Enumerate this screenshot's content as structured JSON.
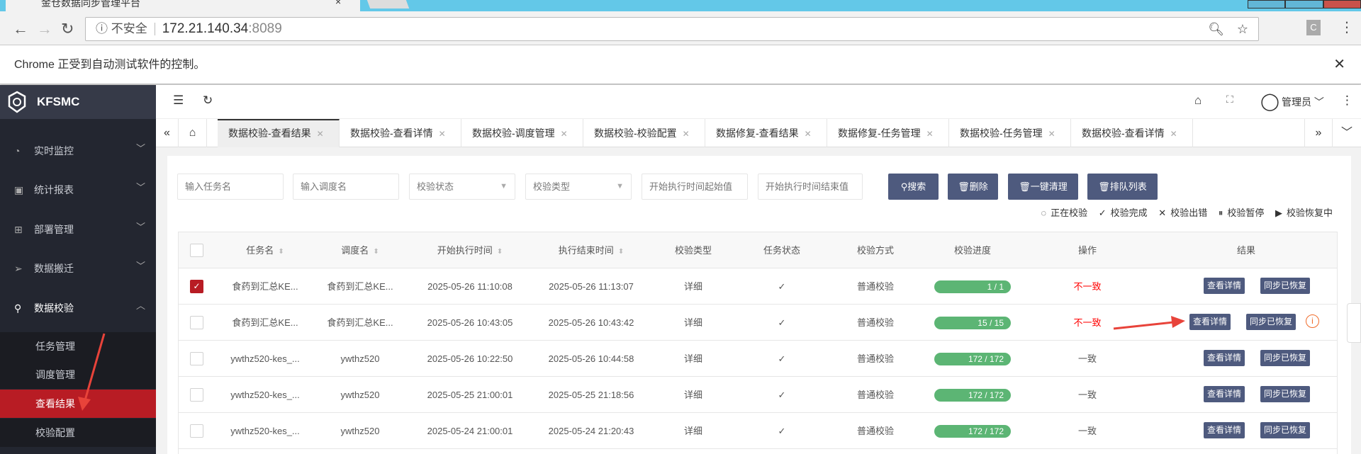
{
  "browser": {
    "tab_title": "金仓数据同步管理平台",
    "security": "不安全",
    "url_host": "172.21.140.34",
    "url_port": ":8089",
    "ext": "C",
    "infobar": "Chrome 正受到自动测试软件的控制。"
  },
  "app": {
    "logo": "KFSMC",
    "user": "管理员"
  },
  "sidebar": {
    "items": [
      {
        "label": "实时监控",
        "icon": "dashboard-icon"
      },
      {
        "label": "统计报表",
        "icon": "report-icon"
      },
      {
        "label": "部署管理",
        "icon": "apps-icon"
      },
      {
        "label": "数据搬迁",
        "icon": "send-icon"
      },
      {
        "label": "数据校验",
        "icon": "search-icon"
      }
    ],
    "sub": [
      "任务管理",
      "调度管理",
      "查看结果",
      "校验配置"
    ],
    "active_sub": "查看结果"
  },
  "tabs": [
    "数据校验-查看结果",
    "数据校验-查看详情",
    "数据校验-调度管理",
    "数据校验-校验配置",
    "数据修复-查看结果",
    "数据修复-任务管理",
    "数据校验-任务管理",
    "数据校验-查看详情"
  ],
  "filters": {
    "task_name": "输入任务名",
    "schedule_name": "输入调度名",
    "status": "校验状态",
    "type": "校验类型",
    "start_from": "开始执行时间起始值",
    "start_to": "开始执行时间结束值"
  },
  "buttons": {
    "search": "搜索",
    "delete": "删除",
    "clear": "一键清理",
    "queue": "排队列表"
  },
  "legend": {
    "running": "正在校验",
    "done": "校验完成",
    "error": "校验出错",
    "paused": "校验暂停",
    "resuming": "校验恢复中"
  },
  "table": {
    "headers": [
      "任务名",
      "调度名",
      "开始执行时间",
      "执行结束时间",
      "校验类型",
      "任务状态",
      "校验方式",
      "校验进度",
      "操作",
      "结果"
    ],
    "rows": [
      {
        "checked": true,
        "task": "食药到汇总KE...",
        "sched": "食药到汇总KE...",
        "start": "2025-05-26 11:10:08",
        "end": "2025-05-26 11:13:07",
        "type": "详细",
        "status": "✓",
        "method": "普通校验",
        "progress": "1 / 1",
        "op": "不一致"
      },
      {
        "checked": false,
        "task": "食药到汇总KE...",
        "sched": "食药到汇总KE...",
        "start": "2025-05-26 10:43:05",
        "end": "2025-05-26 10:43:42",
        "type": "详细",
        "status": "✓",
        "method": "普通校验",
        "progress": "15 / 15",
        "op": "不一致",
        "info": true
      },
      {
        "checked": false,
        "task": "ywthz520-kes_...",
        "sched": "ywthz520",
        "start": "2025-05-26 10:22:50",
        "end": "2025-05-26 10:44:58",
        "type": "详细",
        "status": "✓",
        "method": "普通校验",
        "progress": "172 / 172",
        "op": "一致"
      },
      {
        "checked": false,
        "task": "ywthz520-kes_...",
        "sched": "ywthz520",
        "start": "2025-05-25 21:00:01",
        "end": "2025-05-25 21:18:56",
        "type": "详细",
        "status": "✓",
        "method": "普通校验",
        "progress": "172 / 172",
        "op": "一致"
      },
      {
        "checked": false,
        "task": "ywthz520-kes_...",
        "sched": "ywthz520",
        "start": "2025-05-24 21:00:01",
        "end": "2025-05-24 21:20:43",
        "type": "详细",
        "status": "✓",
        "method": "普通校验",
        "progress": "172 / 172",
        "op": "一致"
      }
    ],
    "detail_label": "查看详情",
    "restore_label": "同步已恢复"
  },
  "colors": {
    "accent": "#b81c24",
    "button": "#4e5a7e",
    "progress": "#5cb574",
    "sidebar": "#232630"
  }
}
